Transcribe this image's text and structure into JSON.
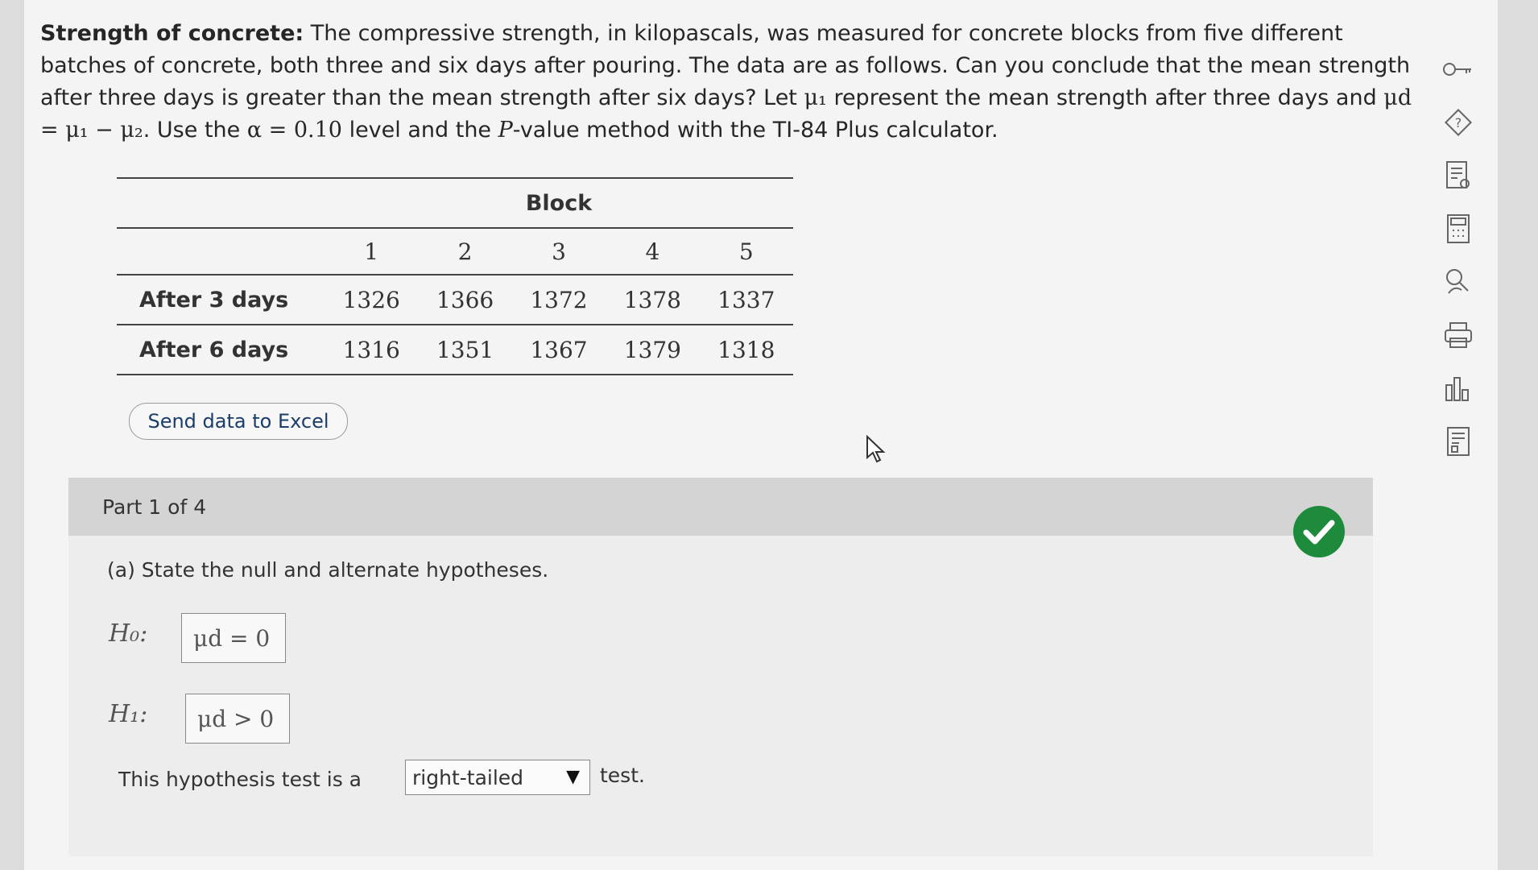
{
  "problem": {
    "title": "Strength of concrete:",
    "text1": " The compressive strength, in kilopascals, was measured for concrete blocks from five different batches of concrete, both three and six days after pouring. The data are as follows. Can you conclude that the mean strength after three days is greater than the mean strength after six days? Let ",
    "mu1": "μ₁",
    "text2": " represent the mean strength after three days and ",
    "mud_def": "μd = μ₁ − μ₂",
    "text3": ". Use the ",
    "alpha": "α = 0.10",
    "text4": " level and the ",
    "p": "P",
    "text5": "-value method with the TI-84 Plus calculator."
  },
  "table": {
    "group_header": "Block",
    "columns": [
      "1",
      "2",
      "3",
      "4",
      "5"
    ],
    "rows": [
      {
        "label": "After 3 days",
        "values": [
          "1326",
          "1366",
          "1372",
          "1378",
          "1337"
        ]
      },
      {
        "label": "After 6 days",
        "values": [
          "1316",
          "1351",
          "1367",
          "1379",
          "1318"
        ]
      }
    ]
  },
  "excel_button": "Send data to Excel",
  "part": {
    "header": "Part 1 of 4",
    "question": "(a) State the null and alternate hypotheses.",
    "h0_label": "H₀:",
    "h0_value": "μd  =  0",
    "h1_label": "H₁:",
    "h1_value": "μd  >  0",
    "test_prefix": "This hypothesis test is a",
    "test_selected": "right-tailed",
    "test_suffix": "test."
  },
  "colors": {
    "check": "#1e8a3c",
    "link_text": "#1a3d6b"
  },
  "toolbar_icons": [
    "key-icon",
    "help-icon",
    "worksheet-icon",
    "calculator-icon",
    "search-person-icon",
    "print-icon",
    "chart-icon",
    "data-icon"
  ]
}
